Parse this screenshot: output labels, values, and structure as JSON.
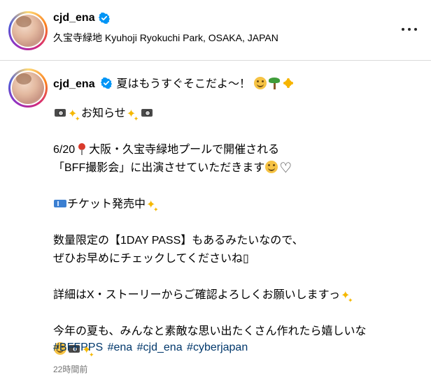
{
  "header": {
    "username": "cjd_ena",
    "location": "久宝寺緑地 Kyuhoji Ryokuchi Park, OSAKA, JAPAN",
    "more_icon": "more-horizontal-icon"
  },
  "caption": {
    "username": "cjd_ena",
    "first_line": "夏はもうすぐそこだよ〜！",
    "announce": "お知らせ",
    "event_line1": "6/20",
    "event_line1_b": "大阪・久宝寺緑地プールで開催される",
    "event_line2": "「BFF撮影会」に出演させていただきます",
    "ticket": "チケット発売中",
    "limited_line1": "数量限定の【1DAY PASS】もあるみたいなので、",
    "limited_line2": "ぜひお早めにチェックしてくださいね▯",
    "details": "詳細はX・ストーリーからご確認よろしくお願いしますっ",
    "closing_line1": "今年の夏も、みんなと素敵な思い出たくさん作れたら嬉しいな",
    "hashtags": [
      "#BFFPPS",
      "#ena",
      "#cjd_ena",
      "#cyberjapan"
    ],
    "timestamp": "22時間前"
  },
  "colors": {
    "verified": "#0095f6",
    "hashtag": "#00376b",
    "timestamp": "#737373",
    "divider": "#dbdbdb"
  }
}
